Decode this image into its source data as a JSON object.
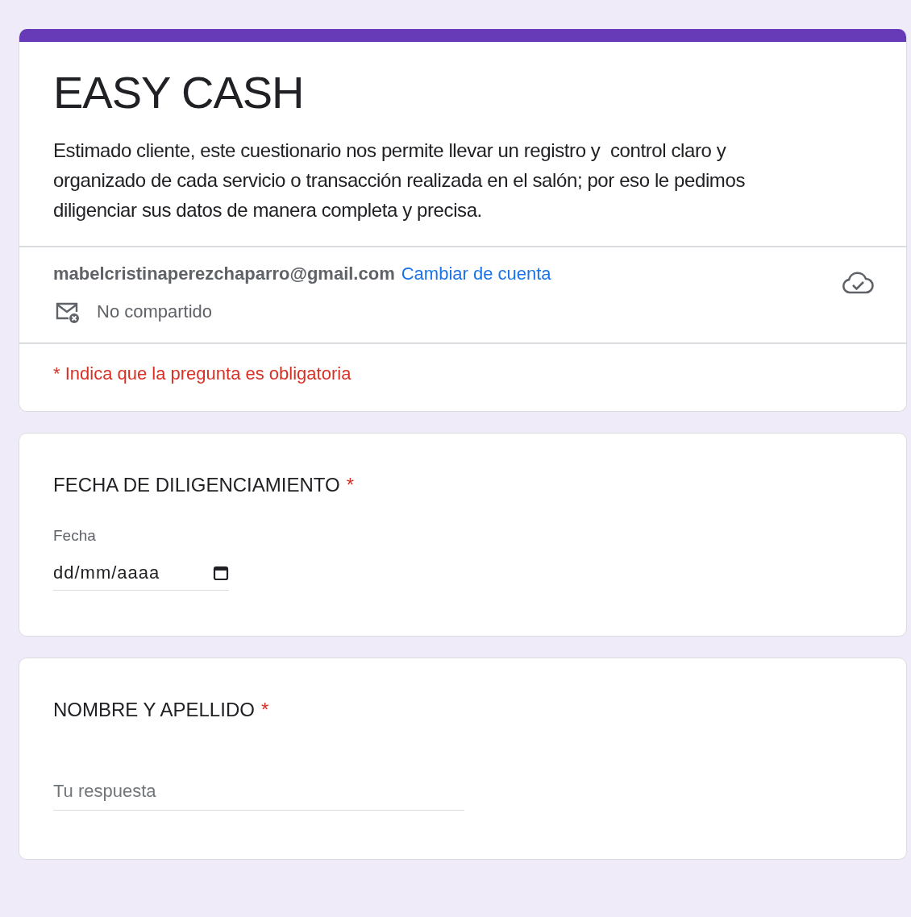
{
  "form": {
    "title": "EASY CASH",
    "description": "Estimado cliente, este cuestionario nos permite llevar un registro y  control claro y organizado de cada servicio o transacción realizada en el salón; por eso le pedimos diligenciar sus datos de manera completa y precisa."
  },
  "account": {
    "email": "mabelcristinaperezchaparro@gmail.com",
    "switch_link": "Cambiar de cuenta",
    "sharing": "No compartido",
    "saved": true
  },
  "required_note": "* Indica que la pregunta es obligatoria",
  "questions": [
    {
      "kind": "date",
      "title": "FECHA DE DILIGENCIAMIENTO",
      "required": true,
      "required_mark": "*",
      "label": "Fecha",
      "placeholder": "dd/mm/aaaa"
    },
    {
      "kind": "text",
      "title": "NOMBRE Y APELLIDO",
      "required": true,
      "required_mark": "*",
      "placeholder": "Tu respuesta"
    }
  ]
}
